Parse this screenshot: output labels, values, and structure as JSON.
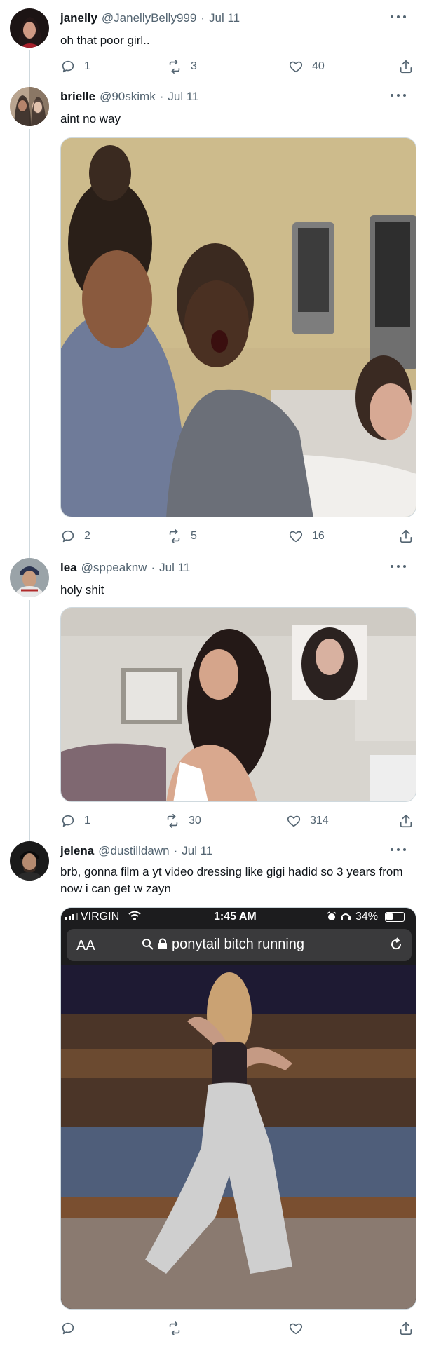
{
  "tweets": [
    {
      "name": "janelly",
      "handle": "@JanellyBelly999",
      "date": "Jul 11",
      "text": "oh that poor girl..",
      "replies": "1",
      "retweets": "3",
      "likes": "40"
    },
    {
      "name": "brielle",
      "handle": "@90skimk",
      "date": "Jul 11",
      "text": "aint no way",
      "replies": "2",
      "retweets": "5",
      "likes": "16"
    },
    {
      "name": "lea",
      "handle": "@sppeaknw",
      "date": "Jul 11",
      "text": "holy shit",
      "replies": "1",
      "retweets": "30",
      "likes": "314"
    },
    {
      "name": "jelena",
      "handle": "@dustilldawn",
      "date": "Jul 11",
      "text": "brb, gonna film a yt video dressing like gigi hadid so 3 years from now i can get w zayn",
      "replies": "",
      "retweets": "",
      "likes": ""
    }
  ],
  "phone_screenshot": {
    "carrier": "VIRGIN",
    "time": "1:45 AM",
    "battery": "34%",
    "aa": "AA",
    "url": "ponytail bitch running"
  },
  "colors": {
    "text": "#0f1419",
    "secondary": "#536471",
    "line": "#cfd9de"
  },
  "icons": [
    "reply-icon",
    "retweet-icon",
    "like-icon",
    "share-icon",
    "more-icon"
  ]
}
